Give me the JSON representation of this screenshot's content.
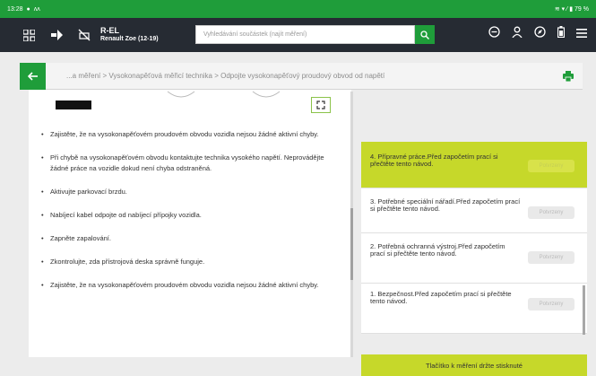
{
  "status_bar": {
    "time": "13:28",
    "right": "≋ ▾ ⁄ ▮ 79 %"
  },
  "vehicle": {
    "code": "R-EL",
    "model": "Renault Zoe (12-19)"
  },
  "search": {
    "placeholder": "Vyhledávání součástek (najít měření)"
  },
  "breadcrumb": "...a měření > Vysokonapěťová měřicí technika > Odpojte vysokonapěťový proudový obvod od napětí",
  "instructions": [
    "Zajistěte, že na vysokonapěťovém proudovém obvodu vozidla nejsou žádné aktivní chyby.",
    "Při chybě na vysokonapěťovém obvodu kontaktujte technika vysokého napětí. Neprovádějte žádné práce na vozidle dokud není chyba odstraněná.",
    "Aktivujte parkovací brzdu.",
    "Nabíjecí kabel odpojte od nabíjecí přípojky vozidla.",
    "Zapněte zapalování.",
    "Zkontrolujte, zda přístrojová deska správně funguje.",
    "Zajistěte, že na vysokonapěťovém proudovém obvodu vozidla nejsou žádné aktivní chyby."
  ],
  "steps": [
    {
      "text": "4. Přípravné práce.Před započetím prací si přečtěte tento návod.",
      "button": "Potvrzeny",
      "active": true
    },
    {
      "text": "3. Potřebné speciální nářadí.Před započetím prací si přečtěte tento návod.",
      "button": "Potvrzeny",
      "active": false
    },
    {
      "text": "2. Potřebná ochranná výstroj.Před započetím prací si přečtěte tento návod.",
      "button": "Potvrzeny",
      "active": false
    },
    {
      "text": "1. Bezpečnost.Před započetím prací si přečtěte tento návod.",
      "button": "Potvrzeny",
      "active": false
    }
  ],
  "hold_button": "Tlačítko k měření držte stisknuté",
  "colors": {
    "brand_green": "#1f9d3a",
    "accent_lime": "#c6d82a",
    "topbar": "#262b33"
  }
}
